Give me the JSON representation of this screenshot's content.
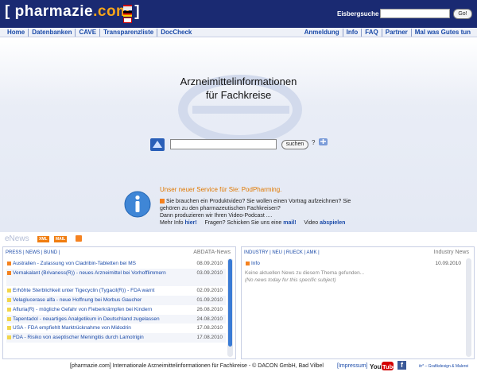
{
  "header": {
    "logo_open": "[",
    "logo_name": "pharmazie",
    "logo_tld": ".com",
    "logo_close": "]",
    "search_label": "Eisbergsuche ®",
    "search_value": "",
    "search_button": "Go!"
  },
  "nav": {
    "left": [
      "Home",
      "Datenbanken",
      "CAVE",
      "Transparenzliste",
      "DocCheck"
    ],
    "right": [
      "Anmeldung",
      "Info",
      "FAQ",
      "Partner",
      "Mal was Gutes tun"
    ]
  },
  "hero": {
    "title_line1": "Arzneimittelinformationen",
    "title_line2": "für Fachkreise",
    "search_value": "",
    "search_button": "suchen",
    "help": "?"
  },
  "promo": {
    "title": "Unser neuer Service für Sie: PodPharming.",
    "line1": "Sie brauchen ein Produktvideo? Sie wollen einen Vortrag aufzeichnen? Sie gehören zu den pharmazeutischen Fachkreisen?",
    "line2": "Dann produzieren wir Ihren Video-Podcast ....",
    "more_prefix": "Mehr Info",
    "more_link": "hier!",
    "question": "Fragen? Schicken Sie uns eine",
    "mail_link": "mail!",
    "video_prefix": "Video",
    "video_link": "abspielen"
  },
  "enews": {
    "label": "eNews",
    "tag_xml": "XML",
    "tag_mail": "MAIL"
  },
  "left_panel": {
    "tabs": "PRESS | NEWS | BUND |",
    "source": "ABDATA-News",
    "items": [
      {
        "title": "Australien - Zulassung von Cladribin-Tabletten bei MS",
        "date": "08.09.2010",
        "icon": "rss-orange"
      },
      {
        "title": "Vernakalant (Brivaness(R)) - neues Arzneimittel bei Vorhofflimmern",
        "date": "03.09.2010",
        "icon": "rss-orange"
      },
      {
        "title": "Erhöhte Sterblichkeit unter Tigecyclin (Tygacil(R)) - FDA warnt",
        "date": "02.09.2010",
        "icon": "yellow-square"
      },
      {
        "title": "Velaglucerase alfa - neue Hoffnung bei Morbus Gaucher",
        "date": "01.09.2010",
        "icon": "yellow-square"
      },
      {
        "title": "Afluria(R) - mögliche Gefahr von Fieberkrämpfen bei Kindern",
        "date": "26.08.2010",
        "icon": "yellow-square"
      },
      {
        "title": "Tapentadol - neuartiges Analgetikum in Deutschland zugelassen",
        "date": "24.08.2010",
        "icon": "yellow-square"
      },
      {
        "title": "USA - FDA empfiehlt Marktrücknahme von Midodrin",
        "date": "17.08.2010",
        "icon": "yellow-square"
      },
      {
        "title": "FDA - Risiko von aseptischer Meningitis durch Lamotrigin",
        "date": "17.08.2010",
        "icon": "yellow-square"
      }
    ]
  },
  "right_panel": {
    "tabs": "INDUSTRY | NEU | RUECK | AMK |",
    "source": "Industry News",
    "item_title": "Info",
    "item_date": "10.09.2010",
    "empty_de": "Keine aktuellen News zu diesem Thema gefunden...",
    "empty_en": "(No news today for this specific subject)"
  },
  "footer": {
    "text": "[pharmazie.com] Internationale Arzneimittelinformationen für Fachkreise - © DACON GmbH, Bad Vilbel",
    "impressum": "[Impressum]",
    "youtube": "YouTube",
    "facebook": "f",
    "credit": "itr* – Grafikdesign & Malerei"
  },
  "colors": {
    "header_bg": "#1a2a72",
    "accent_orange": "#f7a51a",
    "link_blue": "#1a4aa8",
    "rss_orange": "#f58220",
    "bullet_yellow": "#f2d64b"
  }
}
